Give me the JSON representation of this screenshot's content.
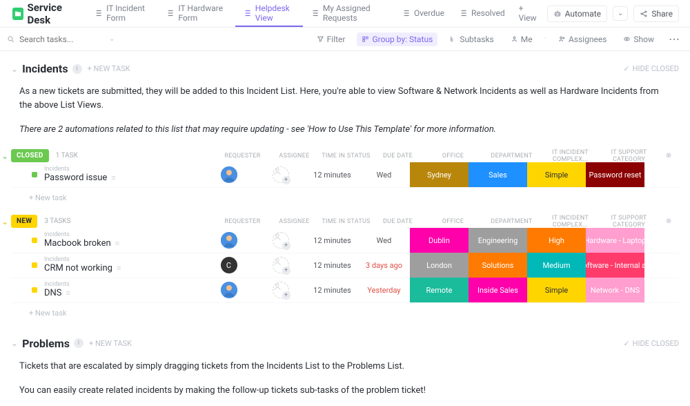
{
  "header": {
    "folder_title": "Service Desk",
    "tabs": [
      {
        "label": "IT Incident Form",
        "active": false
      },
      {
        "label": "IT Hardware Form",
        "active": false
      },
      {
        "label": "Helpdesk View",
        "active": true
      },
      {
        "label": "My Assigned Requests",
        "active": false
      },
      {
        "label": "Overdue",
        "active": false
      },
      {
        "label": "Resolved",
        "active": false
      }
    ],
    "add_view": "+ View",
    "automate": "Automate",
    "share": "Share"
  },
  "filterbar": {
    "search_placeholder": "Search tasks...",
    "filter": "Filter",
    "group_by": "Group by: Status",
    "subtasks": "Subtasks",
    "me": "Me",
    "assignees": "Assignees",
    "show": "Show"
  },
  "sections": {
    "incidents": {
      "title": "Incidents",
      "new_task": "+ NEW TASK",
      "hide_closed": "HIDE CLOSED",
      "desc_main": "As a new tickets are submitted, they will be added to this Incident List. Here, you're able to view Software & Network Incidents as well as Hardware Incidents from the above List Views.",
      "desc_note": "There are 2 automations related to this list that may require updating - see 'How to Use This Template' for more information."
    },
    "problems": {
      "title": "Problems",
      "new_task": "+ NEW TASK",
      "hide_closed": "HIDE CLOSED",
      "desc1": "Tickets that are escalated by simply dragging tickets from the Incidents List to the Problems List.",
      "desc2": "You can easily create related incidents by making the follow-up tickets sub-tasks of the problem ticket!"
    }
  },
  "columns": [
    "REQUESTER",
    "ASSIGNEE",
    "TIME IN STATUS",
    "DUE DATE",
    "OFFICE",
    "DEPARTMENT",
    "IT INCIDENT COMPLEX...",
    "IT SUPPORT CATEGORY"
  ],
  "groups": [
    {
      "status": "CLOSED",
      "status_color": "#6bc950",
      "dot_color": "#6bc950",
      "chevron_color": "#6bc950",
      "task_count": "1 TASK",
      "tasks": [
        {
          "breadcrumb": "Incidents",
          "name": "Password issue",
          "requester_type": "avatar",
          "time": "12 minutes",
          "due": "Wed",
          "due_overdue": false,
          "tags": [
            {
              "label": "Sydney",
              "color": "#b8860b"
            },
            {
              "label": "Sales",
              "color": "#1e90ff"
            },
            {
              "label": "Simple",
              "color": "#ffd500",
              "text": "#292d34"
            },
            {
              "label": "Password reset",
              "color": "#8b0000"
            }
          ]
        }
      ],
      "add_task": "+ New task"
    },
    {
      "status": "NEW",
      "status_color": "#ffd500",
      "status_text": "#292d34",
      "dot_color": "#ffd500",
      "chevron_color": "#e0c200",
      "task_count": "3 TASKS",
      "tasks": [
        {
          "breadcrumb": "Incidents",
          "name": "Macbook broken",
          "requester_type": "avatar",
          "time": "12 minutes",
          "due": "Wed",
          "due_overdue": false,
          "tags": [
            {
              "label": "Dublin",
              "color": "#ff00aa"
            },
            {
              "label": "Engineering",
              "color": "#9e9e9e"
            },
            {
              "label": "High",
              "color": "#ff7a00"
            },
            {
              "label": "Hardware - Laptop",
              "color": "#ff9ecf"
            }
          ]
        },
        {
          "breadcrumb": "Incidents",
          "name": "CRM not working",
          "requester_type": "dark",
          "requester_initial": "C",
          "time": "12 minutes",
          "due": "3 days ago",
          "due_overdue": true,
          "tags": [
            {
              "label": "London",
              "color": "#9e9e9e"
            },
            {
              "label": "Solutions",
              "color": "#ff7a00"
            },
            {
              "label": "Medium",
              "color": "#00b8b8"
            },
            {
              "label": "Software - Internal a...",
              "color": "#ff3b6b"
            }
          ]
        },
        {
          "breadcrumb": "Incidents",
          "name": "DNS",
          "requester_type": "avatar",
          "time": "12 minutes",
          "due": "Yesterday",
          "due_overdue": true,
          "tags": [
            {
              "label": "Remote",
              "color": "#1abc9c"
            },
            {
              "label": "Inside Sales",
              "color": "#ff00aa"
            },
            {
              "label": "Simple",
              "color": "#ffd500",
              "text": "#292d34"
            },
            {
              "label": "Network - DNS",
              "color": "#ff9ecf"
            }
          ]
        }
      ],
      "add_task": "+ New task"
    }
  ]
}
